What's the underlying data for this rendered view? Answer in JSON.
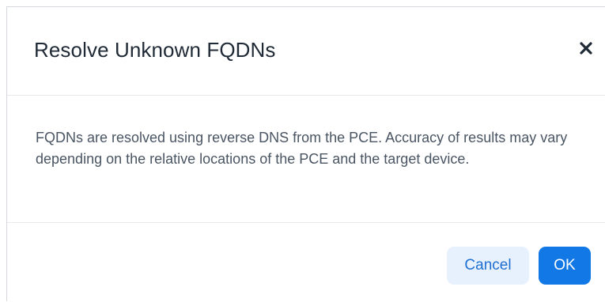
{
  "dialog": {
    "title": "Resolve Unknown FQDNs",
    "close_icon": "close-icon",
    "message": "FQDNs are resolved using reverse DNS from the PCE. Accuracy of results may vary depending on the relative locations of the PCE and the target device.",
    "cancel_label": "Cancel",
    "ok_label": "OK"
  },
  "colors": {
    "title_text": "#1f2a36",
    "body_text": "#4a5563",
    "primary_button": "#1278e6",
    "secondary_button_bg": "#e6f1fd",
    "secondary_button_text": "#1f6fd1",
    "divider": "#e7e9ec"
  }
}
